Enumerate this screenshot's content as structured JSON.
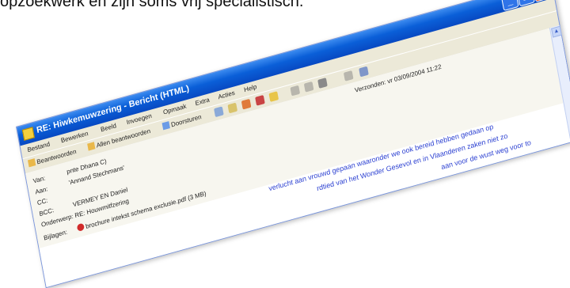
{
  "caption": "opzoekwerk en zijn soms vrij specialistisch.",
  "window": {
    "title": "RE: Hiwkemuwzering - Bericht (HTML)",
    "controls": {
      "minimize": "_",
      "maximize": "□",
      "close": "✕"
    }
  },
  "menu": [
    "Bestand",
    "Bewerken",
    "Beeld",
    "Invoegen",
    "Opmaak",
    "Extra",
    "Acties",
    "Help"
  ],
  "toolbar": {
    "reply": "Beantwoorden",
    "reply_all": "Allen beantwoorden",
    "forward": "Doorsturen"
  },
  "header": {
    "sent_label": "Verzonden:",
    "sent_value": "vr 03/09/2004 11:22",
    "from_label": "Van:",
    "from_value": "pnte Dhana C)",
    "to_label": "Aan:",
    "to_value": "'Annand Stechmans'",
    "cc_label": "CC:",
    "cc_value": "",
    "bcc_label": "BCC:",
    "bcc_value": "VERMEY EN Daniel",
    "subject_label": "Onderwerp:",
    "subject_value": "RE: Houwmitfzering",
    "attach_label": "Bijlagen:",
    "attach_value": "brochure intekst schema exclusie.pdf (3 MB)"
  },
  "body": {
    "line1": "verlucht aan vrouwd gepaan waaronder we ook bereid hebben gedaan op",
    "line2": "rdtied van het Wonder Gesevol en in Vlaanderen zaken niet zo",
    "line3": "aan voor de wust weg voor to"
  },
  "colors": {
    "titlebar": "#0a5fd8",
    "body_text": "#2a3fd1",
    "close": "#d9532c"
  }
}
